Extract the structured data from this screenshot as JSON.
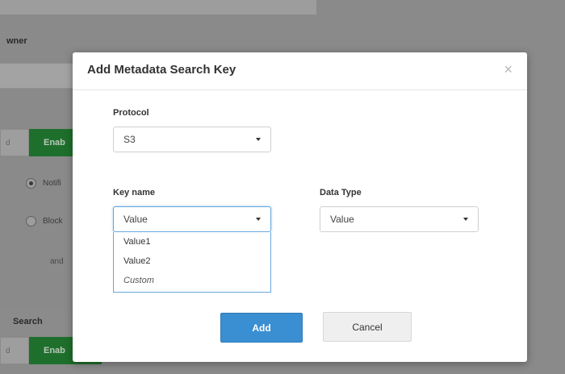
{
  "background": {
    "owner_label": "wner",
    "toggle_off_label": "d",
    "toggle_on_label": "Enab",
    "radio_1_label": "Notifi",
    "radio_2_label": "Block",
    "and_text": "and",
    "search_label": "Search",
    "colors": {
      "enabled_green": "#1f6f2c",
      "overlay": "#8a8a8a"
    }
  },
  "modal": {
    "title": "Add Metadata Search Key",
    "close_glyph": "×",
    "protocol": {
      "label": "Protocol",
      "value": "S3"
    },
    "key_name": {
      "label": "Key name",
      "value": "Value",
      "options": [
        "Value1",
        "Value2",
        "Custom"
      ]
    },
    "data_type": {
      "label": "Data Type",
      "value": "Value"
    },
    "add_label": "Add",
    "cancel_label": "Cancel",
    "colors": {
      "primary": "#3a8fd2",
      "focus": "#66a8dd"
    }
  }
}
